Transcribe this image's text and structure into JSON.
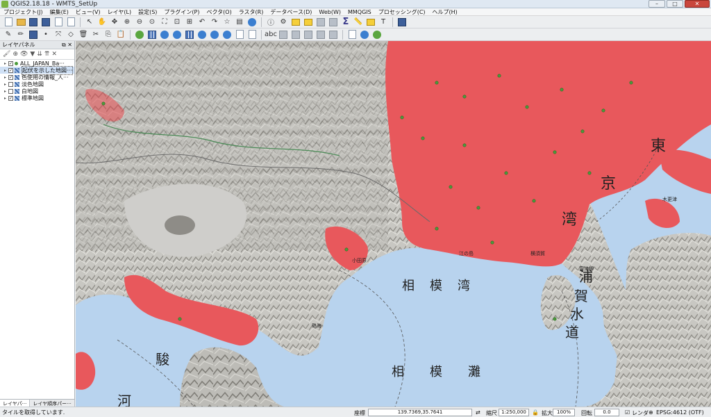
{
  "window": {
    "title": "QGIS2.18.18 - WMTS_SetUp"
  },
  "menu": [
    "プロジェクト(J)",
    "編集(E)",
    "ビュー(V)",
    "レイヤ(L)",
    "設定(S)",
    "プラグイン(P)",
    "ベクタ(O)",
    "ラスタ(R)",
    "データベース(D)",
    "Web(W)",
    "MMQGIS",
    "プロセッシング(C)",
    "ヘルプ(H)"
  ],
  "layers_panel": {
    "title": "レイヤパネル",
    "layers": [
      {
        "name": "ALL_JAPAN_Ba···",
        "checked": true,
        "type": "point"
      },
      {
        "name": "起伏を示した地図···",
        "checked": true,
        "type": "raster",
        "selected": true
      },
      {
        "name": "色使用の情報_人···",
        "checked": true,
        "type": "raster"
      },
      {
        "name": "淡色地図",
        "checked": false,
        "type": "raster"
      },
      {
        "name": "白地図",
        "checked": false,
        "type": "raster"
      },
      {
        "name": "標準地図",
        "checked": true,
        "type": "raster"
      }
    ],
    "tabs": [
      "レイヤパ···",
      "レイヤ順序パー···"
    ]
  },
  "map_labels": {
    "tokyo1": "東",
    "tokyo2": "京",
    "tokyo3": "湾",
    "sagami1": "相",
    "sagami2": "模",
    "sagami3": "湾",
    "nada1": "相",
    "nada2": "模",
    "nada3": "灘",
    "uraga1": "浦",
    "uraga2": "賀",
    "uraga3": "水",
    "uraga4": "道",
    "suruga1": "駿",
    "suruga2": "河",
    "enoshima": "江の島",
    "yokosuka": "横須賀",
    "futtsu": "富津岬",
    "kisarazu": "木更津",
    "odawara": "小田原",
    "atami": "熱海"
  },
  "status": {
    "message": "タイルを取得しています.",
    "coord_label": "座標",
    "coord": "139.7369,35.7641",
    "scale_label": "縮尺",
    "scale": "1:250,000",
    "zoom_label": "拡大",
    "zoom": "100%",
    "rotation_label": "回転",
    "rotation": "0.0",
    "render_label": "レンダ",
    "crs": "EPSG:4612 (OTF)"
  },
  "colors": {
    "urban": "#e8585c",
    "sea": "#b8d3ee",
    "terrain": "#c9c8c4"
  }
}
